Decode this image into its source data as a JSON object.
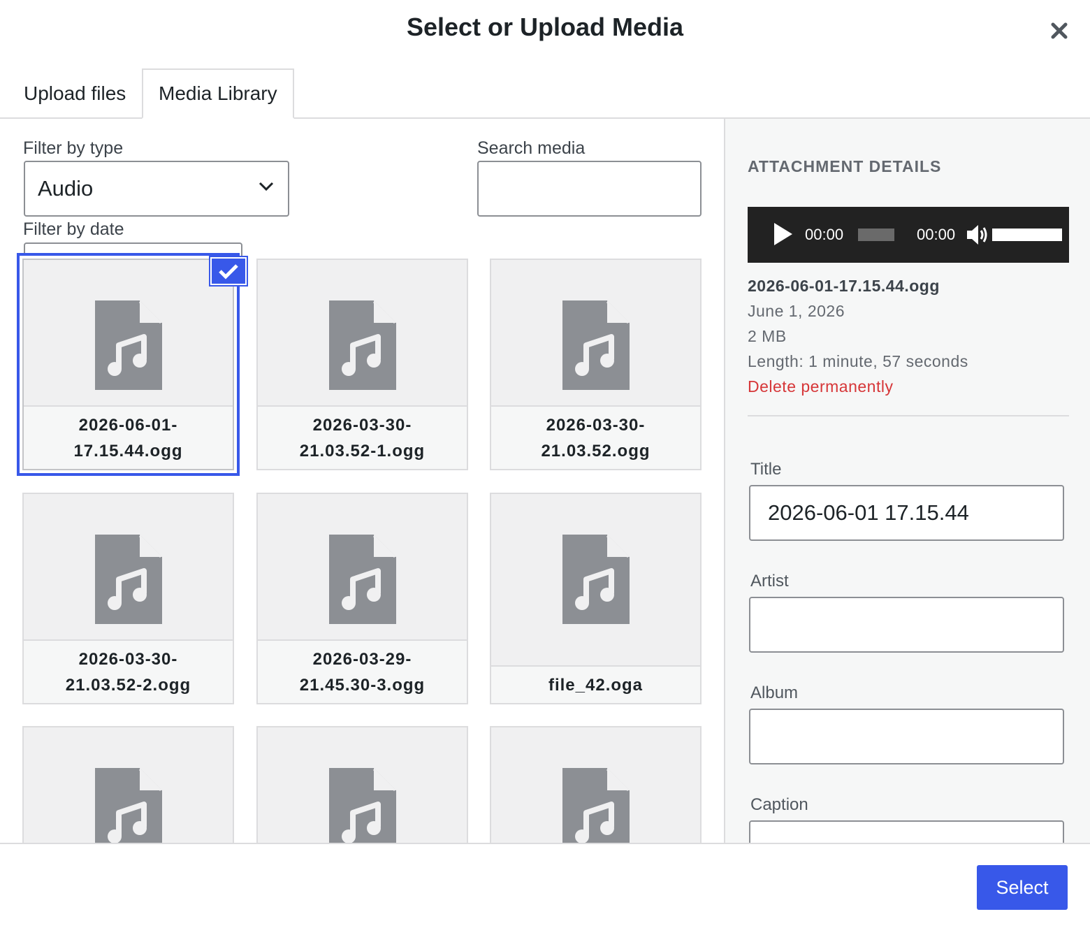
{
  "modal": {
    "title": "Select or Upload Media"
  },
  "tabs": [
    {
      "label": "Upload files"
    },
    {
      "label": "Media Library"
    }
  ],
  "filters": {
    "type_label": "Filter by type",
    "type_value": "Audio",
    "search_label": "Search media",
    "search_value": "",
    "date_label": "Filter by date"
  },
  "media": [
    {
      "name": "2026-06-01-17.15.44.ogg",
      "line1": "2026-06-01-",
      "line2": "17.15.44.ogg",
      "selected": true
    },
    {
      "name": "2026-03-30-21.03.52-1.ogg",
      "line1": "2026-03-30-",
      "line2": "21.03.52-1.ogg",
      "selected": false
    },
    {
      "name": "2026-03-30-21.03.52.ogg",
      "line1": "2026-03-30-",
      "line2": "21.03.52.ogg",
      "selected": false
    },
    {
      "name": "2026-03-30-21.03.52-2.ogg",
      "line1": "2026-03-30-",
      "line2": "21.03.52-2.ogg",
      "selected": false
    },
    {
      "name": "2026-03-29-21.45.30-3.ogg",
      "line1": "2026-03-29-",
      "line2": "21.45.30-3.ogg",
      "selected": false
    },
    {
      "name": "file_42.oga",
      "line1": "",
      "line2": "file_42.oga",
      "selected": false
    }
  ],
  "details": {
    "heading": "ATTACHMENT DETAILS",
    "player": {
      "current_time": "00:00",
      "duration": "00:00"
    },
    "filename": "2026-06-01-17.15.44.ogg",
    "date": "June 1, 2026",
    "size": "2 MB",
    "length": "Length: 1 minute, 57 seconds",
    "delete_label": "Delete permanently",
    "fields": {
      "title_label": "Title",
      "title_value": "2026-06-01 17.15.44",
      "artist_label": "Artist",
      "artist_value": "",
      "album_label": "Album",
      "album_value": "",
      "caption_label": "Caption",
      "caption_value": ""
    }
  },
  "footer": {
    "select_label": "Select"
  },
  "colors": {
    "accent": "#3858e9",
    "danger": "#d63638",
    "icon": "#8c8f94"
  }
}
